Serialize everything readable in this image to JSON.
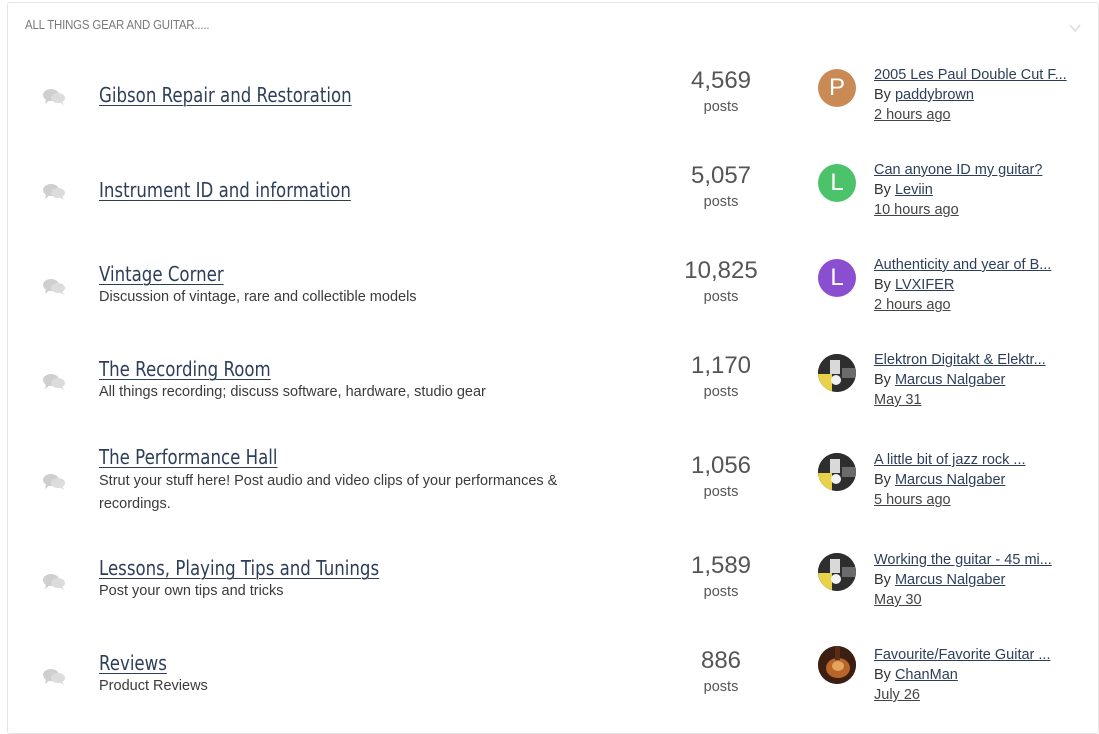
{
  "category": {
    "title": "ALL THINGS GEAR AND GUITAR....."
  },
  "icons": {
    "forum": "chat-bubbles-icon",
    "collapse": "chevron-down-icon"
  },
  "colors": {
    "link": "#2d3e58",
    "avatar_p": "#c98a56",
    "avatar_l1": "#4cc36a",
    "avatar_l2": "#8a4fd1"
  },
  "forums": [
    {
      "title": "Gibson Repair and Restoration",
      "description": "",
      "count": "4,569",
      "count_label": "posts",
      "last": {
        "topic": "2005 Les Paul Double Cut F...",
        "by": "By",
        "author": "paddybrown",
        "time": "2 hours ago",
        "avatar_letter": "P"
      }
    },
    {
      "title": "Instrument ID and information",
      "description": "",
      "count": "5,057",
      "count_label": "posts",
      "last": {
        "topic": "Can anyone ID my guitar?",
        "by": "By",
        "author": "Leviin",
        "time": "10 hours ago",
        "avatar_letter": "L"
      }
    },
    {
      "title": "Vintage Corner",
      "description": "Discussion of vintage, rare and collectible models",
      "count": "10,825",
      "count_label": "posts",
      "last": {
        "topic": "Authenticity and year of B...",
        "by": "By",
        "author": "LVXIFER",
        "time": "2 hours ago",
        "avatar_letter": "L"
      }
    },
    {
      "title": "The Recording Room",
      "description": "All things recording; discuss software, hardware, studio gear",
      "count": "1,170",
      "count_label": "posts",
      "last": {
        "topic": "Elektron Digitakt & Elektr...",
        "by": "By",
        "author": "Marcus Nalgaber",
        "time": "May 31",
        "avatar_letter": ""
      }
    },
    {
      "title": "The Performance Hall",
      "description": "Strut your stuff here! Post audio and video clips of your performances & recordings.",
      "count": "1,056",
      "count_label": "posts",
      "last": {
        "topic": "A little bit of jazz rock ...",
        "by": "By",
        "author": "Marcus Nalgaber",
        "time": "5 hours ago",
        "avatar_letter": ""
      }
    },
    {
      "title": "Lessons, Playing Tips and Tunings",
      "description": "Post your own tips and tricks",
      "count": "1,589",
      "count_label": "posts",
      "last": {
        "topic": "Working the guitar - 45 mi...",
        "by": "By",
        "author": "Marcus Nalgaber",
        "time": "May 30",
        "avatar_letter": ""
      }
    },
    {
      "title": "Reviews",
      "description": "Product Reviews",
      "count": "886",
      "count_label": "posts",
      "last": {
        "topic": "Favourite/Favorite Guitar ...",
        "by": "By",
        "author": "ChanMan",
        "time": "July 26",
        "avatar_letter": ""
      }
    }
  ]
}
